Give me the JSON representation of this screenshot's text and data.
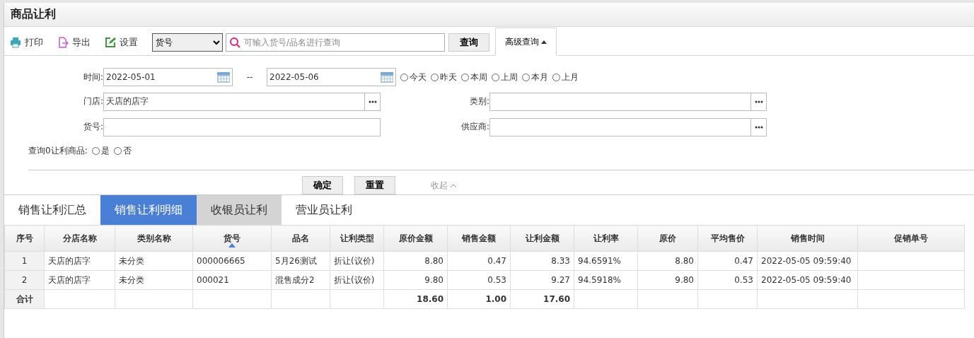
{
  "title": "商品让利",
  "toolbar": {
    "actions": [
      {
        "kind": "print",
        "label": "打印"
      },
      {
        "kind": "export",
        "label": "导出"
      },
      {
        "kind": "settings",
        "label": "设置"
      }
    ],
    "select": "货号",
    "search_placeholder": "可输入货号/品名进行查询",
    "query": "查询",
    "advanced": "高级查询",
    "advanced_expanded": true
  },
  "filters": {
    "time_label": "时间:",
    "start": "2022-05-01",
    "separator": "--",
    "end": "2022-05-06",
    "quick": [
      {
        "label": "今天",
        "selected": false
      },
      {
        "label": "昨天",
        "selected": false
      },
      {
        "label": "本周",
        "selected": false
      },
      {
        "label": "上周",
        "selected": false
      },
      {
        "label": "本月",
        "selected": false
      },
      {
        "label": "上月",
        "selected": false
      }
    ],
    "store_label": "门店:",
    "store": "天店的店字",
    "category_label": "类别:",
    "item_label": "货号:",
    "supplier_label": "供应商:",
    "zero_label": "查询0让利商品:",
    "zero_options": [
      {
        "label": "是",
        "selected": false
      },
      {
        "label": "否",
        "selected": false
      }
    ],
    "confirm": "确定",
    "reset": "重置",
    "collapse": "收起"
  },
  "tabs": [
    {
      "label": "销售让利汇总",
      "selected": false
    },
    {
      "label": "销售让利明细",
      "selected": true
    },
    {
      "label": "收银员让利",
      "selected": false
    },
    {
      "label": "营业员让利",
      "selected": false
    }
  ],
  "table": {
    "columns": [
      {
        "label": "序号",
        "sorted": false
      },
      {
        "label": "分店名称",
        "sorted": false
      },
      {
        "label": "类别名称",
        "sorted": false
      },
      {
        "label": "货号",
        "sorted": true
      },
      {
        "label": "品名",
        "sorted": false
      },
      {
        "label": "让利类型",
        "sorted": false
      },
      {
        "label": "原价金额",
        "sorted": false,
        "total": "18.60"
      },
      {
        "label": "销售金额",
        "sorted": false,
        "total": "1.00"
      },
      {
        "label": "让利金额",
        "sorted": false,
        "total": "17.60"
      },
      {
        "label": "让利率",
        "sorted": false
      },
      {
        "label": "原价",
        "sorted": false
      },
      {
        "label": "平均售价",
        "sorted": false
      },
      {
        "label": "销售时间",
        "sorted": false
      },
      {
        "label": "促销单号",
        "sorted": false
      }
    ],
    "rows": [
      [
        "1",
        "天店的店字",
        "未分类",
        "000006665",
        "5月26测试",
        "折让(议价)",
        "8.80",
        "0.47",
        "8.33",
        "94.6591%",
        "8.80",
        "0.47",
        "2022-05-05 09:59:40",
        ""
      ],
      [
        "2",
        "天店的店字",
        "未分类",
        "000021",
        "混售成分2",
        "折让(议价)",
        "9.80",
        "0.53",
        "9.27",
        "94.5918%",
        "9.80",
        "0.53",
        "2022-05-05 09:59:40",
        ""
      ]
    ],
    "totals_label": "合计"
  }
}
